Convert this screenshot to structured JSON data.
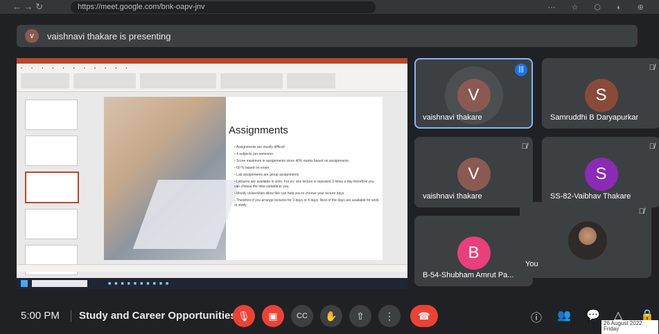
{
  "browser": {
    "nav_symbols": "←   →   ↻",
    "url": "https://meet.google.com/bnk-oapv-jnv",
    "extensions": "⋯ ☆ ⬡ ◐ ⊕"
  },
  "presenting_bar": {
    "avatar_initial": "v",
    "text": "vaishnavi thakare is presenting"
  },
  "shared_screen": {
    "slide_title": "Assignments",
    "slide_bullets": [
      "Assignments are mostly difficult",
      "4 subjects per semester",
      "Score maximum in assignments since 40% marks based on assignments",
      "60 % based on exam",
      "Lab assignments are group assignments",
      "Lectures are available in slots. For ex: one lecture is repeated 3 times a day therefore you can choose the time suitable to you.",
      "Mostly universities allow flex can help you to choose your lecture days",
      "Therefore if you arrange lectures for 3 days or 4 days. Rest of the days are available for work or study"
    ]
  },
  "participants": [
    {
      "initial": "V",
      "name": "vaishnavi thakare",
      "color": "#8a5a52",
      "speaking": true
    },
    {
      "initial": "S",
      "name": "Samruddhi B Daryapurkar",
      "color": "#8a4a3a",
      "muted": true
    },
    {
      "initial": "V",
      "name": "vaishnavi thakare",
      "color": "#8a5a52",
      "muted": true
    },
    {
      "initial": "S",
      "name": "SS-82-Vaibhav Thakare",
      "color": "#8a2bb5",
      "muted": true
    },
    {
      "initial": "B",
      "name": "B-54-Shubham Amrut Pa...",
      "color": "#e8407a"
    }
  ],
  "self_tile": {
    "name": "You"
  },
  "bottom_bar": {
    "time": "5:00 PM",
    "meeting_title": "Study and Career Opportunities i...",
    "controls": {
      "mic": "🎙",
      "camera": "▣",
      "captions": "CC",
      "raise_hand": "✋",
      "present": "⇧",
      "more": "⋮",
      "end_call": "☎"
    },
    "right_icons": {
      "info": "ⓘ",
      "people": "👥",
      "chat": "💬",
      "activities": "△",
      "host": "🔒"
    }
  },
  "taskbar_tooltip": "26 August 2022 Friday",
  "colors": {
    "background": "#202124",
    "tile": "#3c4043",
    "end_call": "#ea4335",
    "active_border": "#8ab4f8"
  }
}
